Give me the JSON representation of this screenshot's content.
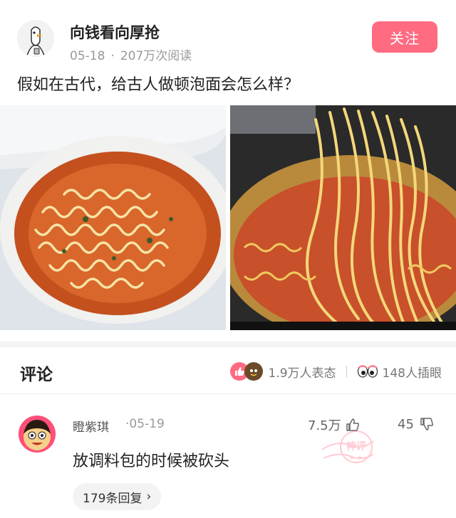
{
  "author": {
    "name": "向钱看向厚抢",
    "date": "05-18",
    "views": "207万次阅读"
  },
  "follow_label": "关注",
  "post": {
    "title": "假如在古代，给古人做顿泡面会怎么样？"
  },
  "comments_section": {
    "title": "评论",
    "reactions": [
      {
        "icon": "thumbs-up-icon",
        "text": "1.9万人表态"
      },
      {
        "icon": "eyes-icon",
        "text": "148人插眼"
      }
    ]
  },
  "comment": {
    "username": "瞪紫琪",
    "date": "·05-19",
    "likes": "7.5万",
    "dislikes": "45",
    "text": "放调料包的时候被砍头",
    "badge": "神评",
    "replies": "179条回复"
  },
  "colors": {
    "accent": "#ff6b81",
    "muted": "#999999"
  }
}
